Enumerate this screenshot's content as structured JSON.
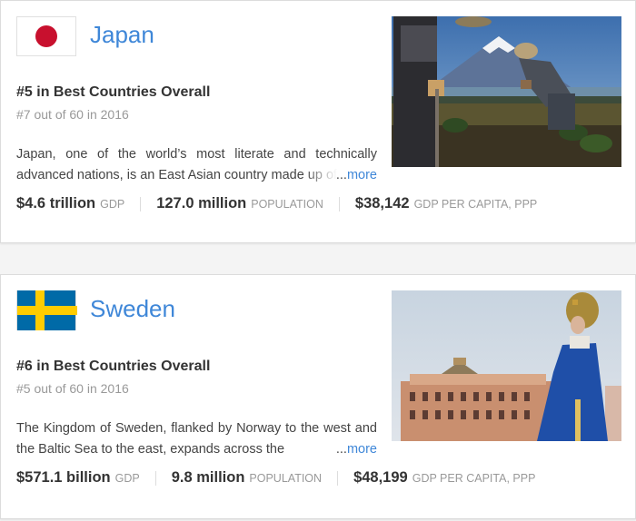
{
  "cards": [
    {
      "flag": "japan-flag",
      "country": "Japan",
      "rank": "#5 in Best Countries Overall",
      "prev_rank": "#7 out of 60 in 2016",
      "description": "Japan, one of the world’s most literate and technically advanced nations, is an East Asian country made up of",
      "ellipsis": "...",
      "more": "more",
      "stats": [
        {
          "value": "$4.6 trillion",
          "label": "GDP"
        },
        {
          "value": "127.0 million",
          "label": "POPULATION"
        },
        {
          "value": "$38,142",
          "label": "GDP PER CAPITA, PPP"
        }
      ]
    },
    {
      "flag": "sweden-flag",
      "country": "Sweden",
      "rank": "#6 in Best Countries Overall",
      "prev_rank": "#5 out of 60 in 2016",
      "description": "The Kingdom of Sweden, flanked by Norway to the west and the Baltic Sea to the east, expands across the",
      "ellipsis": "...",
      "more": "more",
      "stats": [
        {
          "value": "$571.1 billion",
          "label": "GDP"
        },
        {
          "value": "9.8 million",
          "label": "POPULATION"
        },
        {
          "value": "$48,199",
          "label": "GDP PER CAPITA, PPP"
        }
      ]
    }
  ],
  "colors": {
    "link": "#3f87d8",
    "japan_red": "#c8102e",
    "sweden_blue": "#006aa7",
    "sweden_yellow": "#fecc00"
  }
}
